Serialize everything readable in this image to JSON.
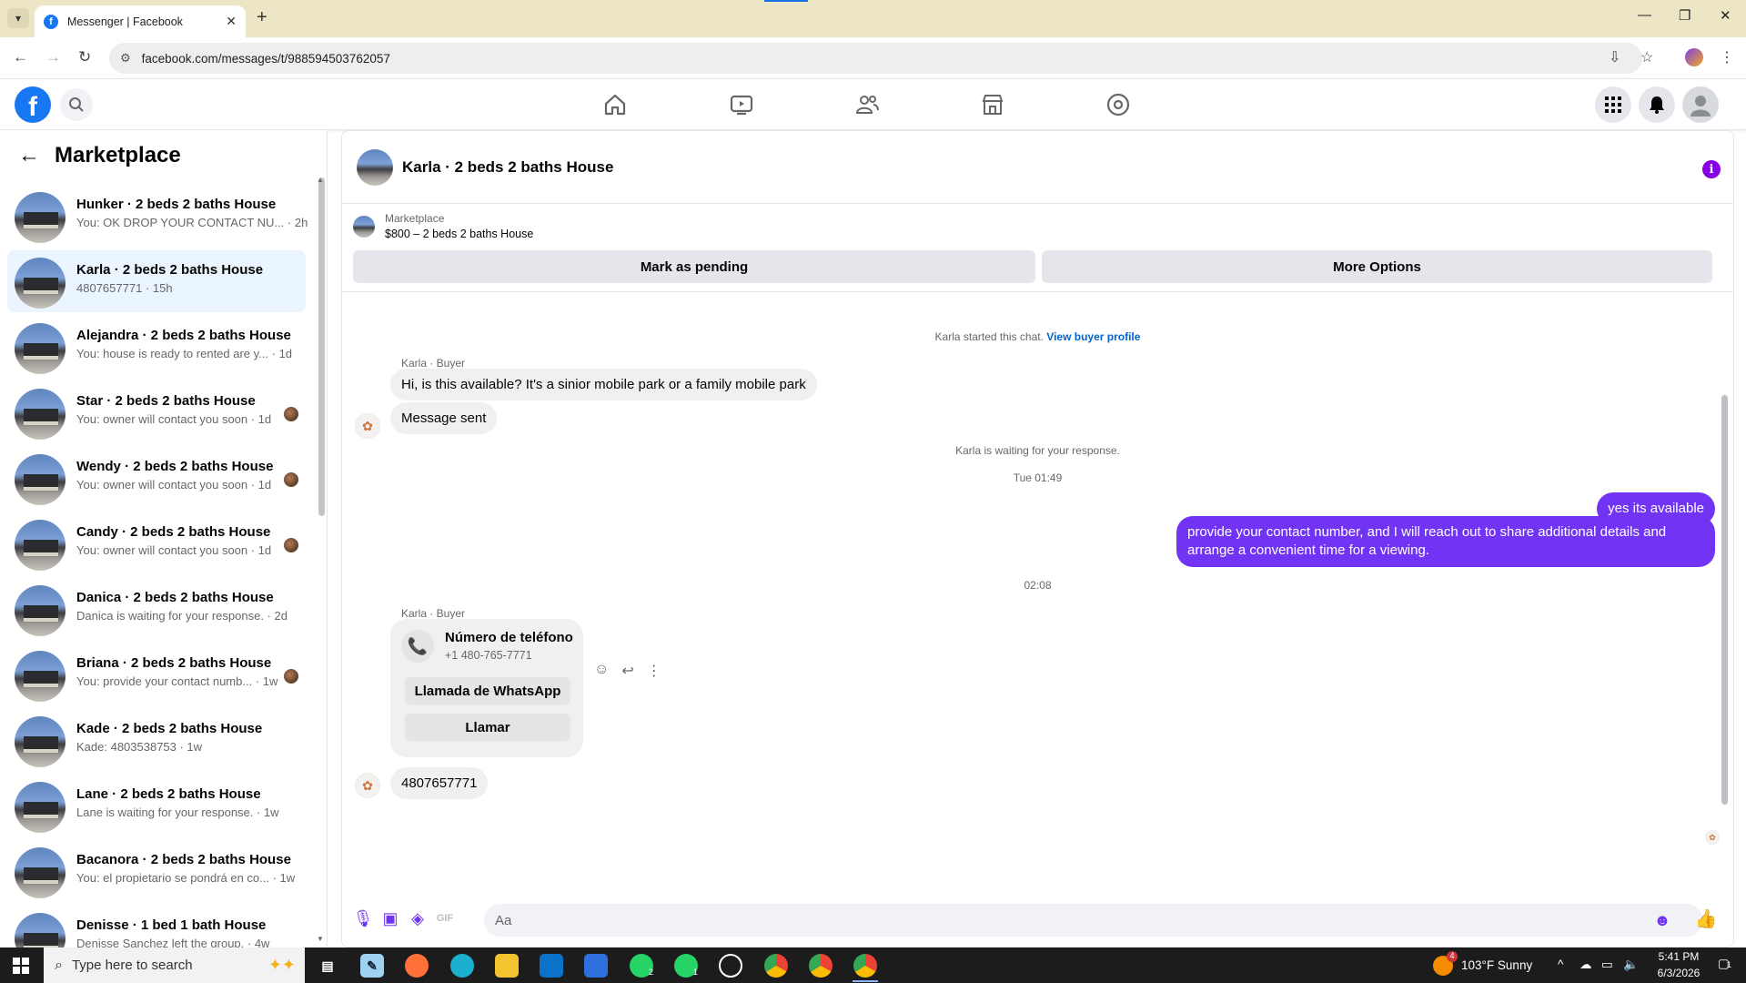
{
  "browser": {
    "tab_title": "Messenger | Facebook",
    "url": "facebook.com/messages/t/988594503762057",
    "favicon_letter": "f"
  },
  "fb": {
    "logo_letter": "f"
  },
  "sidebar": {
    "title": "Marketplace",
    "conversations": [
      {
        "name": "Hunker · 2 beds 2 baths House",
        "preview": "You: OK DROP YOUR CONTACT NU... · 2h",
        "mini": false
      },
      {
        "name": "Karla · 2 beds 2 baths House",
        "preview": "4807657771 · 15h",
        "mini": false,
        "active": true
      },
      {
        "name": "Alejandra · 2 beds 2 baths House",
        "preview": "You: house is ready to rented are y... · 1d",
        "mini": false
      },
      {
        "name": "Star · 2 beds 2 baths House",
        "preview": "You: owner will contact you soon · 1d",
        "mini": true
      },
      {
        "name": "Wendy · 2 beds 2 baths House",
        "preview": "You: owner will contact you soon · 1d",
        "mini": true
      },
      {
        "name": "Candy · 2 beds 2 baths House",
        "preview": "You: owner will contact you soon · 1d",
        "mini": true
      },
      {
        "name": "Danica · 2 beds 2 baths House",
        "preview": "Danica is waiting for your response. · 2d",
        "mini": false
      },
      {
        "name": "Briana · 2 beds 2 baths House",
        "preview": "You: provide your contact numb... · 1w",
        "mini": true
      },
      {
        "name": "Kade · 2 beds 2 baths House",
        "preview": "Kade: 4803538753 · 1w",
        "mini": false
      },
      {
        "name": "Lane · 2 beds 2 baths House",
        "preview": "Lane is waiting for your response. · 1w",
        "mini": false
      },
      {
        "name": "Bacanora · 2 beds 2 baths House",
        "preview": "You: el propietario se pondrá en co... · 1w",
        "mini": false
      },
      {
        "name": "Denisse · 1 bed 1 bath House",
        "preview": "Denisse Sanchez left the group. · 4w",
        "mini": false
      }
    ]
  },
  "chat": {
    "title": "Karla · 2 beds 2 baths House",
    "listing_source": "Marketplace",
    "listing_price": "$800 – 2 beds 2 baths House",
    "btn_pending": "Mark as pending",
    "btn_more": "More Options",
    "started_text": "Karla started this chat.",
    "view_profile": "View buyer profile",
    "sender_label": "Karla · Buyer",
    "msg1": "Hi, is this available? It's a sinior mobile park or a family mobile park",
    "msg2": "Message sent",
    "waiting": "Karla is waiting for your response.",
    "time1": "Tue 01:49",
    "out1": "yes its available",
    "out2": "provide your contact number, and I will reach out to share additional details and arrange a convenient time for a viewing.",
    "time2": "02:08",
    "sender_label2": "Karla · Buyer",
    "phone_title": "Número de teléfono",
    "phone_number": "+1 480-765-7771",
    "btn_whatsapp": "Llamada de WhatsApp",
    "btn_call": "Llamar",
    "msg3": "4807657771",
    "composer_placeholder": "Aa"
  },
  "taskbar": {
    "search_placeholder": "Type here to search",
    "weather": "103°F  Sunny",
    "time": "5:41 PM",
    "date": "6/3/2026",
    "weather_badge": "4",
    "wa_badge1": "2",
    "wa_badge2": "1",
    "notif_count": "1"
  },
  "colors": {
    "accent": "#7134f5",
    "fb_blue": "#1877f2",
    "active_row": "#ebf5ff"
  }
}
